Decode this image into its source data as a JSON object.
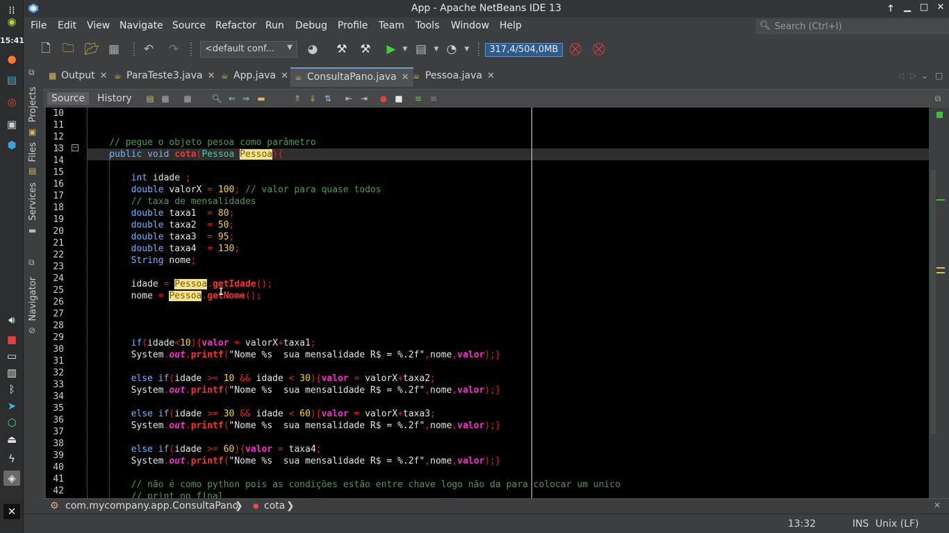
{
  "window": {
    "title": "App - Apache NetBeans IDE 13"
  },
  "os_dock": {
    "clock": "15:41"
  },
  "menu": [
    "File",
    "Edit",
    "View",
    "Navigate",
    "Source",
    "Refactor",
    "Run",
    "Debug",
    "Profile",
    "Team",
    "Tools",
    "Window",
    "Help"
  ],
  "search": {
    "placeholder": "Search (Ctrl+I)"
  },
  "toolbar": {
    "config": "<default conf...",
    "memory": "317,4/504,0MB"
  },
  "side_tabs": [
    "Projects",
    "Files",
    "Services",
    "Navigator"
  ],
  "tabs": [
    {
      "label": "Output"
    },
    {
      "label": "ParaTeste3.java"
    },
    {
      "label": "App.java"
    },
    {
      "label": "ConsultaPano.java"
    },
    {
      "label": "Pessoa.java"
    }
  ],
  "editor_toolbar": {
    "source": "Source",
    "history": "History"
  },
  "line_numbers": [
    "10",
    "11",
    "12",
    "13",
    "14",
    "15",
    "16",
    "17",
    "18",
    "19",
    "20",
    "21",
    "22",
    "23",
    "24",
    "25",
    "26",
    "27",
    "28",
    "29",
    "30",
    "31",
    "32",
    "33",
    "34",
    "35",
    "36",
    "37",
    "38",
    "39",
    "40",
    "41",
    "42"
  ],
  "code": {
    "l12": "// pegue o objeto pesoa como parâmetro",
    "l13": [
      "public void ",
      "cota",
      "(",
      "Pessoa",
      " ",
      "Pessoa",
      "){"
    ],
    "l15": [
      "int",
      " idade ",
      ";"
    ],
    "l16": [
      "double",
      " valorX ",
      "=",
      " ",
      "100",
      ";",
      " // valor para quase todos"
    ],
    "l17": "// taxa de mensalidades",
    "l18": [
      "double",
      " taxa1  ",
      "=",
      " ",
      "80",
      ";"
    ],
    "l19": [
      "double",
      " taxa2  ",
      "=",
      " ",
      "50",
      ";"
    ],
    "l20": [
      "double",
      " taxa3  ",
      "=",
      " ",
      "95",
      ";"
    ],
    "l21": [
      "double",
      " taxa4  ",
      "=",
      " ",
      "130",
      ";"
    ],
    "l22": [
      "String",
      " nome",
      ";"
    ],
    "l24": [
      "idade ",
      "=",
      " ",
      "Pessoa",
      ".",
      "getIdade",
      "();"
    ],
    "l25": [
      "nome ",
      "=",
      " ",
      "Pessoa",
      ".",
      "getNome",
      "();"
    ],
    "l29": [
      "if",
      "(",
      "idade",
      "<",
      "10",
      "){",
      "valor",
      " ",
      "=",
      " valorX",
      "+",
      "taxa1",
      ";"
    ],
    "printf": [
      "System",
      ".",
      "out",
      ".",
      "printf",
      "(",
      "\"Nome %s  sua mensalidade R$ = %.2f\"",
      ",",
      "nome",
      ",",
      "valor",
      ");}"
    ],
    "l32": [
      "else if",
      "(",
      "idade ",
      ">=",
      " ",
      "10",
      " ",
      "&&",
      " idade ",
      "<",
      " ",
      "30",
      "){",
      "valor",
      " ",
      "=",
      " valorX",
      "+",
      "taxa2",
      ";"
    ],
    "l35": [
      "else if",
      "(",
      "idade ",
      ">=",
      " ",
      "30",
      " ",
      "&&",
      " idade ",
      "<",
      " ",
      "60",
      "){",
      "valor",
      " ",
      "=",
      " valorX",
      "+",
      "taxa3",
      ";"
    ],
    "l38": [
      "else if",
      "(",
      "idade ",
      ">=",
      " ",
      "60",
      "){",
      "valor",
      " ",
      "=",
      " taxa4",
      ";"
    ],
    "l41": "// não é como python pois as condições estão entre chave logo não da para colocar um unico",
    "l42": "// print no final"
  },
  "breadcrumb": {
    "class": "com.mycompany.app.ConsultaPano",
    "method": "cota"
  },
  "status": {
    "position": "13:32",
    "mode": "INS",
    "eol": "Unix (LF)"
  },
  "colors": {
    "editor_bg": "#000000",
    "keyword": "#6fb4ff",
    "comment": "#4e9a4e",
    "number": "#ffd700",
    "highlight": "#f5e38a"
  }
}
